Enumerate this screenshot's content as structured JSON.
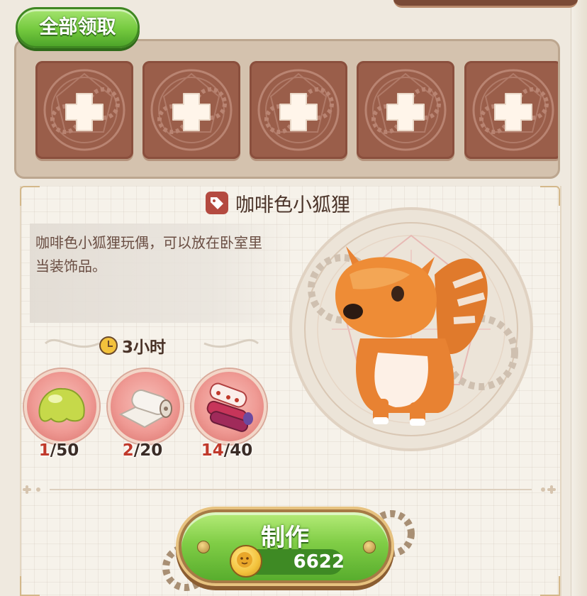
{
  "claim_all": {
    "label": "全部领取"
  },
  "slots": [
    {
      "icon": "plus-icon"
    },
    {
      "icon": "plus-icon"
    },
    {
      "icon": "plus-icon"
    },
    {
      "icon": "plus-icon"
    },
    {
      "icon": "plus-icon"
    }
  ],
  "item": {
    "name": "咖啡色小狐狸",
    "description": "咖啡色小狐狸玩偶，可以放在卧室里当装饰品。",
    "craft_time": "3小时"
  },
  "materials": [
    {
      "icon": "slime-icon",
      "have": "1",
      "need": "/50"
    },
    {
      "icon": "fabric-roll-icon",
      "have": "2",
      "need": "/20"
    },
    {
      "icon": "cloth-rolls-icon",
      "have": "14",
      "need": "/40"
    }
  ],
  "make": {
    "label": "制作",
    "cost": "6622",
    "currency_icon": "coin-icon"
  },
  "colors": {
    "accent_green": "#74c93e",
    "slot_brown": "#9a5e4a",
    "need_red": "#c0392b"
  }
}
